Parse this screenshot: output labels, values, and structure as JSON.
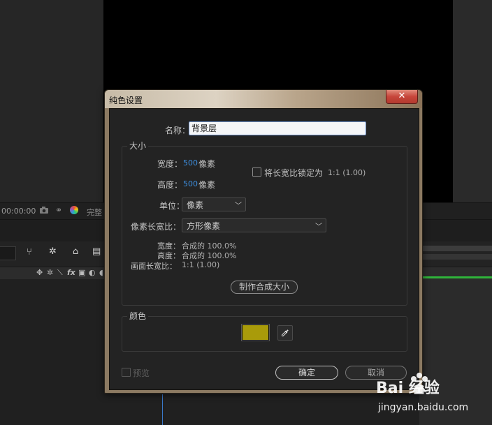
{
  "background": {
    "timecode": "00:00:00",
    "preview_quality_label": "完整"
  },
  "dialog": {
    "title": "纯色设置",
    "close_glyph": "✕",
    "name_label": "名称：",
    "name_value": "背景层",
    "size": {
      "legend": "大小",
      "width_label": "宽度：",
      "width_value": "500",
      "width_unit": "像素",
      "height_label": "高度：",
      "height_value": "500",
      "height_unit": "像素",
      "lock_label": "将长宽比锁定为",
      "lock_ratio": "1:1 (1.00)",
      "lock_checked": false,
      "unit_label": "单位：",
      "unit_value": "像素",
      "pixel_aspect_label": "像素长宽比：",
      "pixel_aspect_value": "方形像素",
      "comp_width_label": "宽度：",
      "comp_width_value": "合成的 100.0%",
      "comp_height_label": "高度：",
      "comp_height_value": "合成的 100.0%",
      "frame_aspect_label": "画面长宽比：",
      "frame_aspect_value": "1:1 (1.00)",
      "make_comp_size_button": "制作合成大小"
    },
    "color": {
      "legend": "颜色",
      "swatch_hex": "#a99b0a"
    },
    "preview_label": "预览",
    "ok_button": "确定",
    "cancel_button": "取消"
  },
  "watermark": {
    "logo_text": "Bai  经验",
    "url": "jingyan.baidu.com"
  }
}
